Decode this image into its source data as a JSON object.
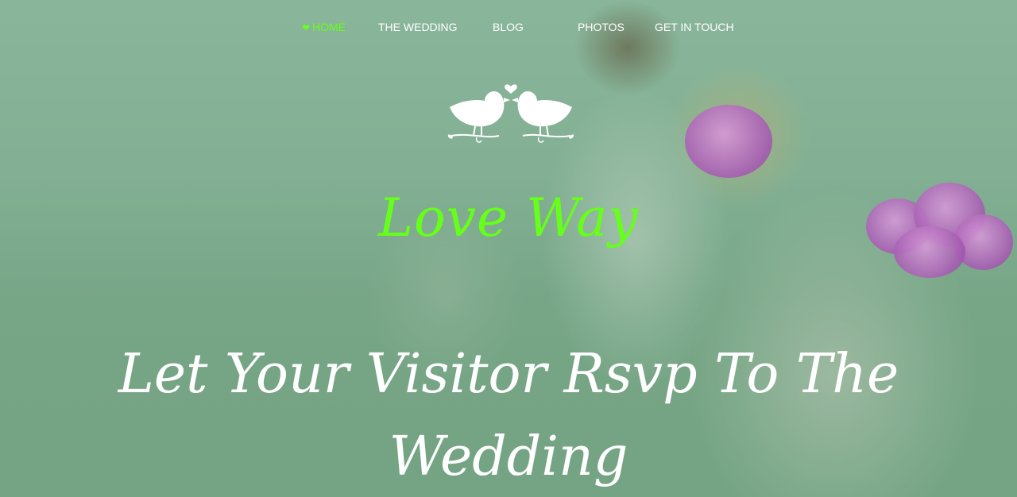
{
  "nav": {
    "items": [
      {
        "label": "HOME",
        "icon": "heart-icon",
        "active": true
      },
      {
        "label": "THE WEDDING"
      },
      {
        "label": "BLOG"
      },
      {
        "label": "PHOTOS"
      },
      {
        "label": "GET IN TOUCH"
      }
    ]
  },
  "hero": {
    "logo_icon": "love-birds-icon",
    "brand": "Love Way",
    "headline": "Let Your Visitor Rsvp To The Wedding"
  },
  "colors": {
    "accent": "#66ff1a",
    "text": "#ffffff",
    "overlay": "#7fa88c"
  }
}
